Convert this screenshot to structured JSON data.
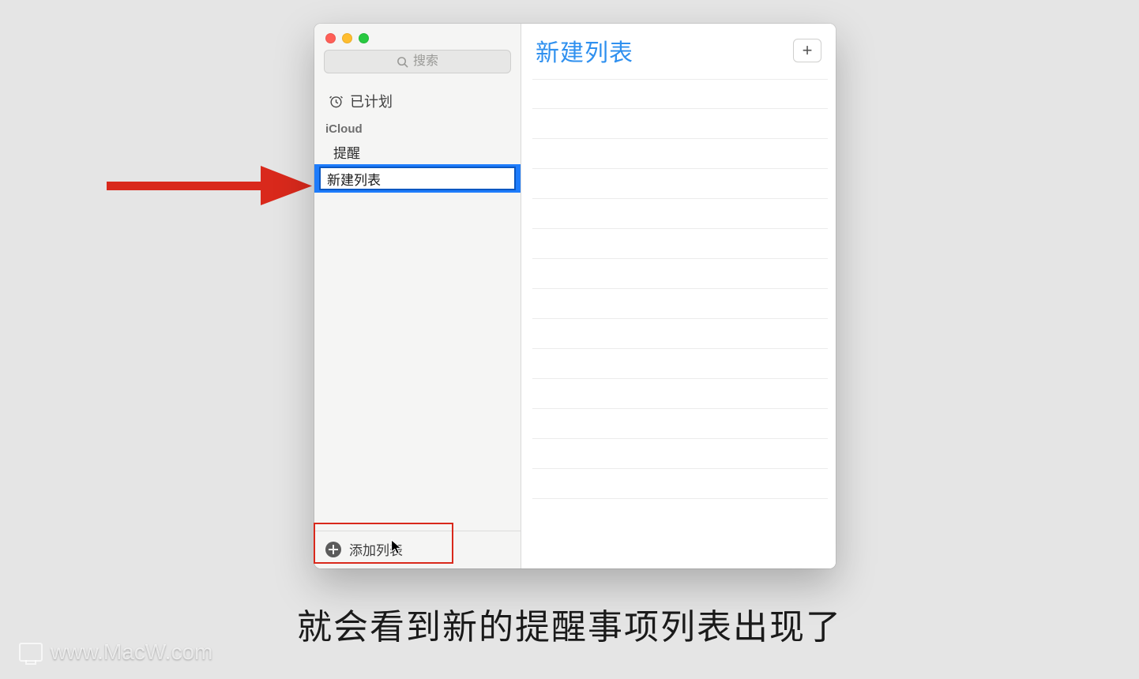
{
  "search": {
    "placeholder": "搜索"
  },
  "sidebar": {
    "scheduled_label": "已计划",
    "section_title": "iCloud",
    "items": [
      {
        "label": "提醒"
      },
      {
        "label": "新建列表"
      }
    ],
    "add_list_label": "添加列表"
  },
  "main": {
    "title": "新建列表",
    "line_count": 14
  },
  "caption": "就会看到新的提醒事项列表出现了",
  "watermark": "www.MacW.com",
  "colors": {
    "selection": "#1e7cfb",
    "title_accent": "#2f90ef",
    "annotation_red": "#d9291c"
  }
}
